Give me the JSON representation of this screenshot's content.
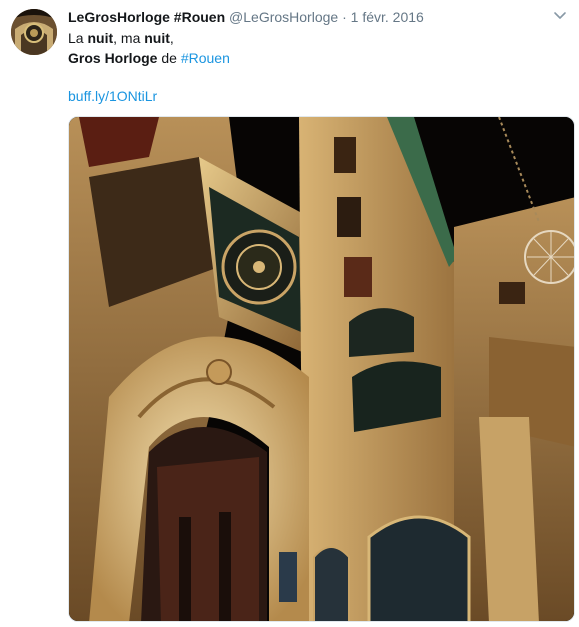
{
  "tweet": {
    "author_name": "LeGrosHorloge #Rouen",
    "author_handle": "@LeGrosHorloge",
    "separator": "·",
    "date": "1 févr. 2016",
    "line1_a": "La ",
    "line1_b": "nuit",
    "line1_c": ", ma ",
    "line1_d": "nuit",
    "line1_e": ",",
    "line2_a": "Gros Horloge",
    "line2_b": " de ",
    "line2_hashtag": "#Rouen",
    "link": "buff.ly/1ONtiLr"
  },
  "icons": {
    "avatar": "clock-tower-avatar",
    "menu": "chevron-down-icon"
  },
  "colors": {
    "link": "#1b95e0",
    "muted": "#657786",
    "text": "#14171a"
  }
}
